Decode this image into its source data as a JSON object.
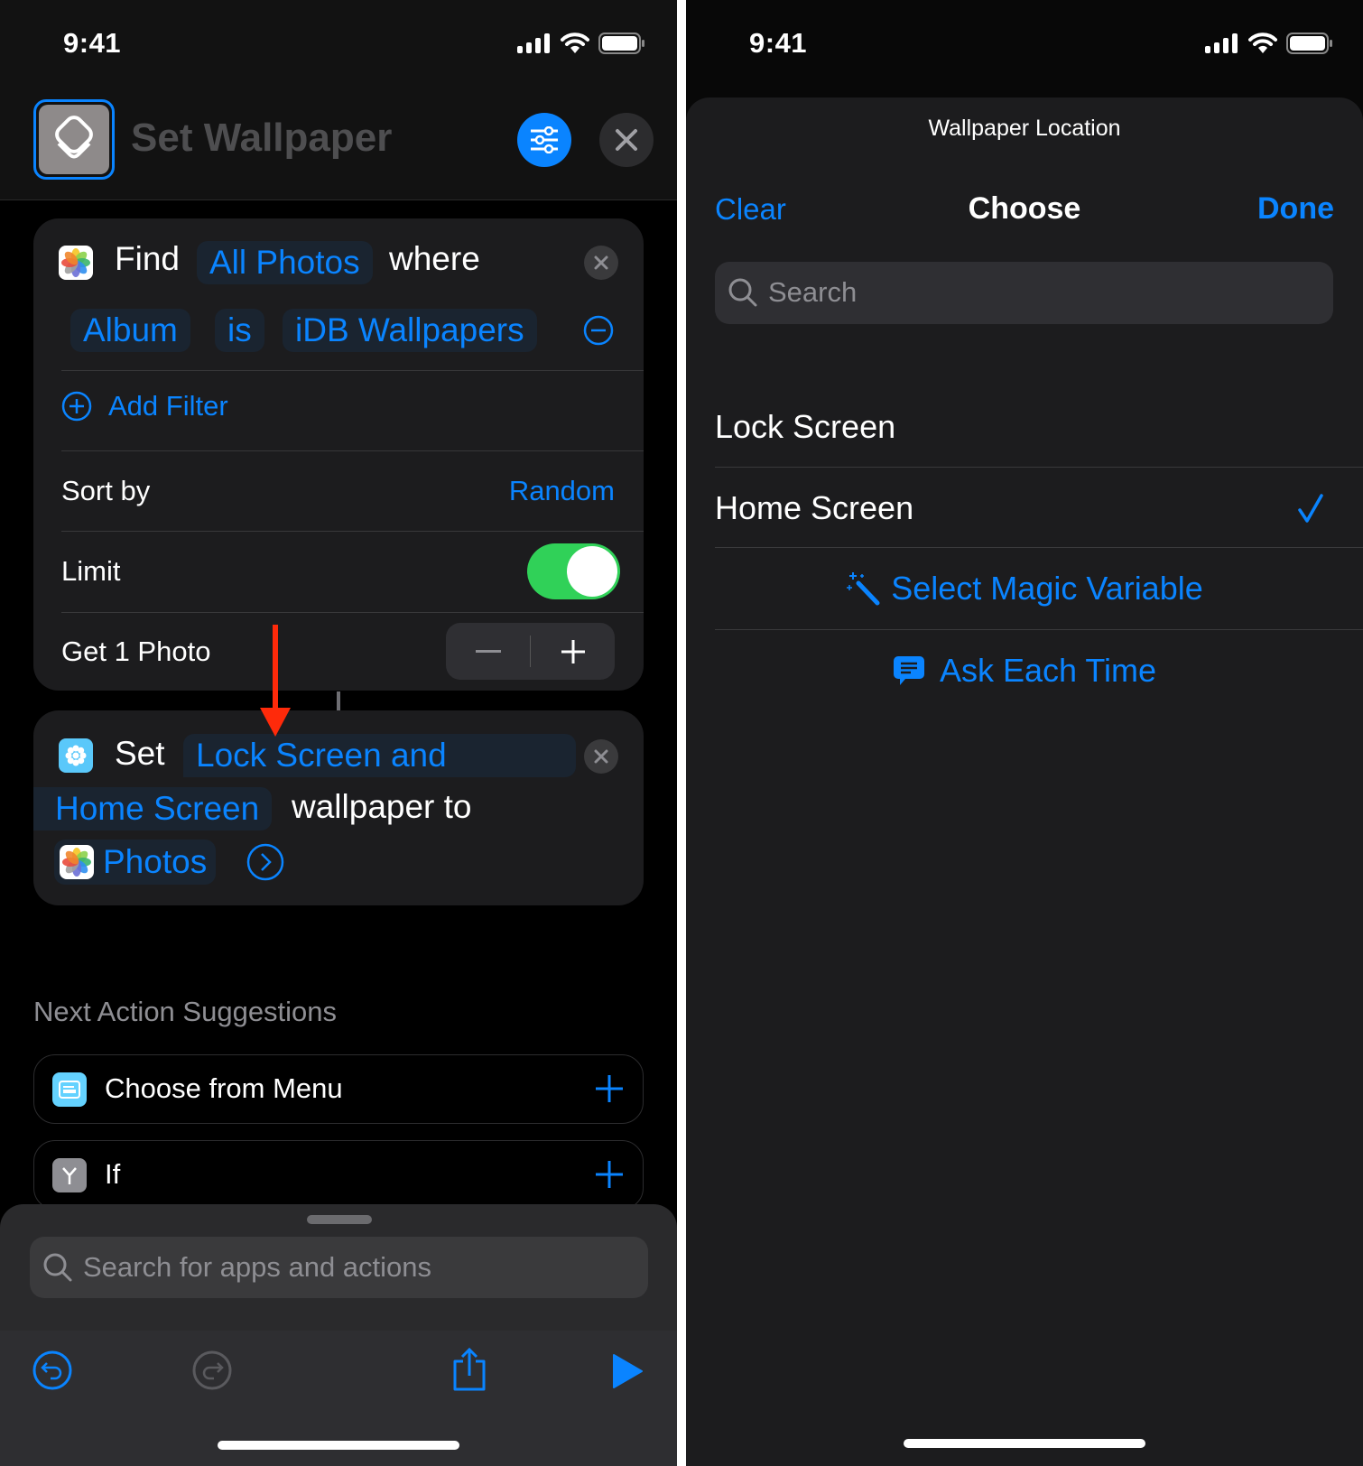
{
  "left": {
    "status": {
      "time": "9:41"
    },
    "header": {
      "title": "Set Wallpaper",
      "app_icon": "shortcuts-icon",
      "settings_icon": "sliders-icon",
      "close_icon": "close-icon"
    },
    "find_action": {
      "verb": "Find",
      "subject": "All Photos",
      "connector": "where",
      "filter": {
        "field": "Album",
        "operator": "is",
        "value": "iDB Wallpapers"
      },
      "add_filter_label": "Add Filter",
      "sort_label": "Sort by",
      "sort_value": "Random",
      "limit_label": "Limit",
      "limit_enabled": true,
      "get_label": "Get 1 Photo",
      "stepper": {
        "minus": "−",
        "plus": "+"
      }
    },
    "set_action": {
      "verb": "Set",
      "location_line1": "Lock Screen and",
      "location_line2": "Home Screen",
      "connector": "wallpaper to",
      "input": "Photos"
    },
    "suggestions": {
      "heading": "Next Action Suggestions",
      "items": [
        {
          "label": "Choose from Menu",
          "icon": "menu-icon",
          "color": "#64d2ff"
        },
        {
          "label": "If",
          "icon": "branch-icon",
          "color": "#8e8e93"
        }
      ]
    },
    "search": {
      "placeholder": "Search for apps and actions"
    },
    "toolbar": {
      "undo": "undo-icon",
      "redo": "redo-icon",
      "share": "share-icon",
      "run": "play-icon"
    }
  },
  "right": {
    "status": {
      "time": "9:41"
    },
    "sheet_title": "Wallpaper Location",
    "nav": {
      "clear": "Clear",
      "title": "Choose",
      "done": "Done"
    },
    "search": {
      "placeholder": "Search"
    },
    "options": [
      {
        "label": "Lock Screen",
        "selected": false
      },
      {
        "label": "Home Screen",
        "selected": true
      }
    ],
    "magic_variable": "Select Magic Variable",
    "ask_each_time": "Ask Each Time"
  },
  "colors": {
    "accent": "#0a84ff",
    "toggle_on": "#30d158",
    "annotation_arrow": "#ff2a0a"
  }
}
